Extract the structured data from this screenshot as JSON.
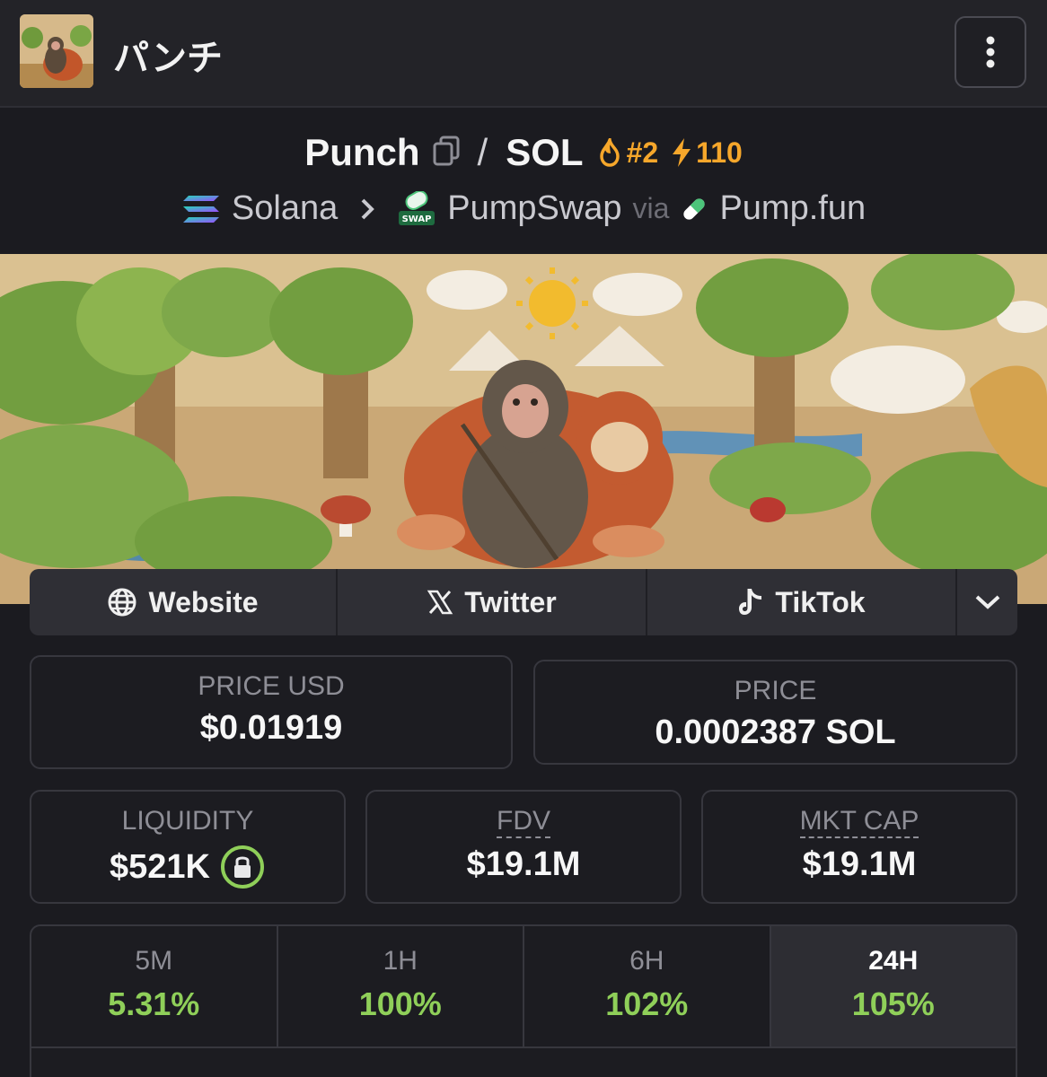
{
  "header": {
    "title": "パンチ",
    "avatar_icon": "punch-token-avatar",
    "menu_icon": "kebab-menu-icon"
  },
  "pair": {
    "base": "Punch",
    "quote": "SOL",
    "slash": "/",
    "trending_rank": "#2",
    "boost_count": "110",
    "accent_color": "#f6a72b"
  },
  "chain": {
    "network": "Solana",
    "dex": "PumpSwap",
    "dex_badge": "SWAP",
    "via_label": "via",
    "launchpad": "Pump.fun"
  },
  "links": [
    {
      "label": "Website",
      "icon": "globe-icon"
    },
    {
      "label": "Twitter",
      "icon": "x-logo-icon"
    },
    {
      "label": "TikTok",
      "icon": "tiktok-icon"
    }
  ],
  "stats": {
    "price_usd": {
      "label": "PRICE USD",
      "value": "$0.01919"
    },
    "price_native": {
      "label": "PRICE",
      "value": "0.0002387 SOL"
    },
    "liquidity": {
      "label": "LIQUIDITY",
      "value": "$521K"
    },
    "fdv": {
      "label": "FDV",
      "value": "$19.1M"
    },
    "mkt_cap": {
      "label": "MKT CAP",
      "value": "$19.1M"
    }
  },
  "timeframes": [
    {
      "label": "5M",
      "value": "5.31%"
    },
    {
      "label": "1H",
      "value": "100%"
    },
    {
      "label": "6H",
      "value": "102%"
    },
    {
      "label": "24H",
      "value": "105%",
      "active": true
    }
  ],
  "colors": {
    "positive": "#8fcf59",
    "lock": "#8fcf59",
    "background": "#1b1b20"
  }
}
